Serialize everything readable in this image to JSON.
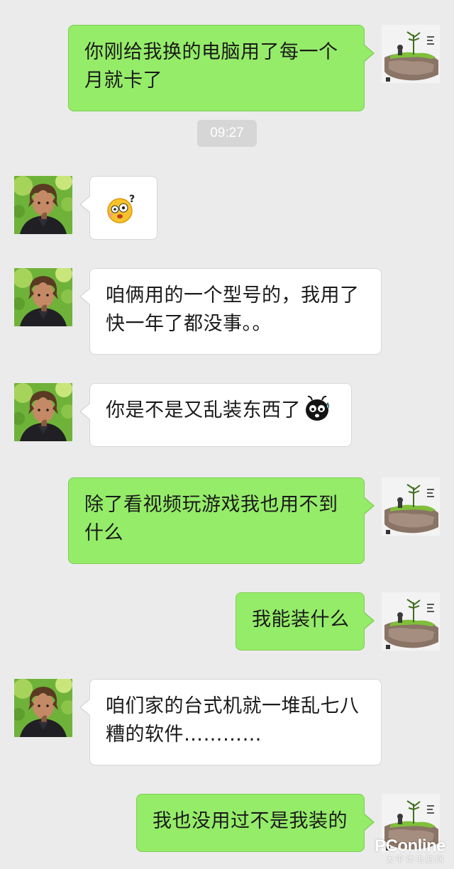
{
  "chat": {
    "timestamp": "09:27",
    "messages": [
      {
        "side": "right",
        "text": "你刚给我换的电脑用了每一个月就卡了"
      },
      {
        "side": "left",
        "emoji": "confused-face-emoji"
      },
      {
        "side": "left",
        "text": "咱俩用的一个型号的，我用了快一年了都没事。。"
      },
      {
        "side": "left",
        "text": "你是不是又乱装东西了",
        "emoji": "sweating-bug-emoji"
      },
      {
        "side": "right",
        "text": "除了看视频玩游戏我也用不到什么"
      },
      {
        "side": "right",
        "text": "我能装什么"
      },
      {
        "side": "left",
        "text": "咱们家的台式机就一堆乱七八糟的软件…………"
      },
      {
        "side": "right",
        "text": "我也没用过不是我装的"
      }
    ]
  },
  "watermark": {
    "brand": "PConline",
    "sub": "太平洋电脑网"
  },
  "colors": {
    "background": "#ebebeb",
    "sent_bubble": "#95ec69",
    "received_bubble": "#ffffff",
    "timestamp_bg": "#d6d6d6"
  }
}
